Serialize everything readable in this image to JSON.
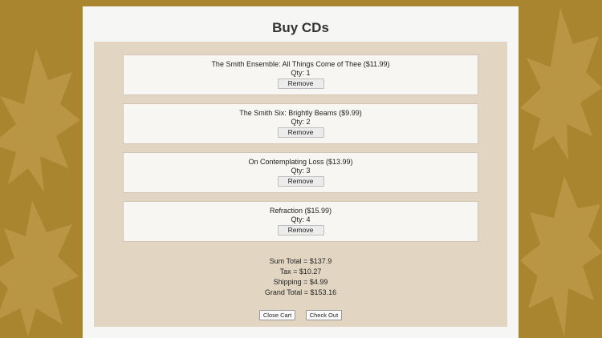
{
  "page": {
    "title": "Buy CDs"
  },
  "cart": {
    "items": [
      {
        "name": "The Smith Ensemble: All Things Come of Thee ($11.99)",
        "qty": "Qty: 1",
        "remove_label": "Remove"
      },
      {
        "name": "The Smith Six: Brightly Beams ($9.99)",
        "qty": "Qty: 2",
        "remove_label": "Remove"
      },
      {
        "name": "On Contemplating Loss ($13.99)",
        "qty": "Qty: 3",
        "remove_label": "Remove"
      },
      {
        "name": "Refraction ($15.99)",
        "qty": "Qty: 4",
        "remove_label": "Remove"
      }
    ],
    "totals": {
      "sum": "Sum Total = $137.9",
      "tax": "Tax = $10.27",
      "shipping": "Shipping = $4.99",
      "grand": "Grand Total = $153.16"
    },
    "actions": {
      "close_label": "Close Cart",
      "checkout_label": "Check Out"
    }
  },
  "colors": {
    "background": "#a9852f",
    "leaf": "#c9a85a",
    "panel": "#f6f6f4",
    "cart_area": "#e2d6c2",
    "item_card": "#f8f6f2"
  }
}
